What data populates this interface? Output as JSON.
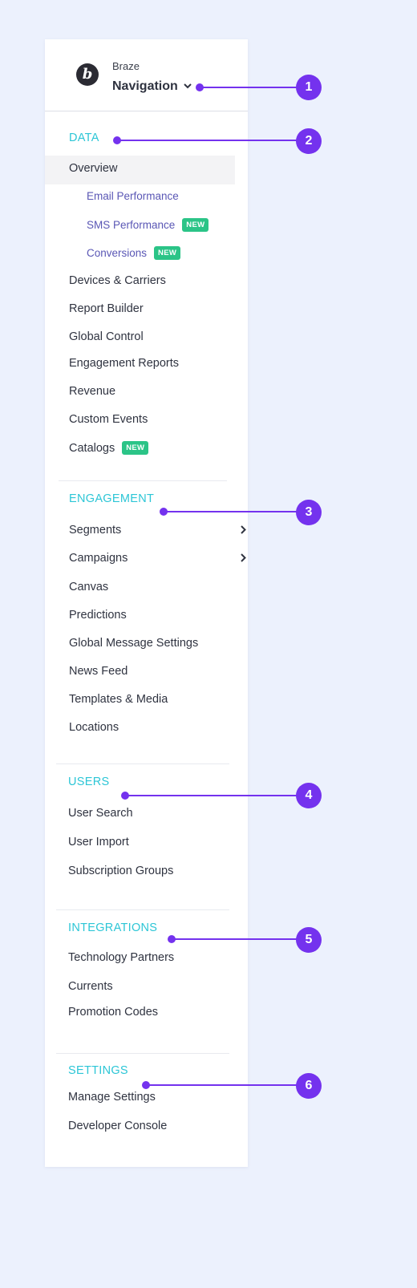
{
  "header": {
    "brand": "Braze",
    "title": "Navigation"
  },
  "data_section": {
    "heading": "DATA",
    "overview": "Overview",
    "sub_items": [
      {
        "label": "Email Performance"
      },
      {
        "label": "SMS Performance",
        "badge": "NEW"
      },
      {
        "label": "Conversions",
        "badge": "NEW"
      }
    ],
    "items": [
      {
        "label": "Devices & Carriers"
      },
      {
        "label": "Report Builder"
      },
      {
        "label": "Global Control"
      },
      {
        "label": "Engagement Reports"
      },
      {
        "label": "Revenue"
      },
      {
        "label": "Custom Events"
      },
      {
        "label": "Catalogs",
        "badge": "NEW"
      }
    ]
  },
  "engagement_section": {
    "heading": "ENGAGEMENT",
    "items": [
      {
        "label": "Segments"
      },
      {
        "label": "Campaigns"
      },
      {
        "label": "Canvas"
      },
      {
        "label": "Predictions"
      },
      {
        "label": "Global Message Settings"
      },
      {
        "label": "News Feed"
      },
      {
        "label": "Templates & Media"
      },
      {
        "label": "Locations"
      }
    ]
  },
  "users_section": {
    "heading": "USERS",
    "items": [
      {
        "label": "User Search"
      },
      {
        "label": "User Import"
      },
      {
        "label": "Subscription Groups"
      }
    ]
  },
  "integrations_section": {
    "heading": "INTEGRATIONS",
    "items": [
      {
        "label": "Technology Partners"
      },
      {
        "label": "Currents"
      },
      {
        "label": "Promotion Codes"
      }
    ]
  },
  "settings_section": {
    "heading": "SETTINGS",
    "items": [
      {
        "label": "Manage Settings"
      },
      {
        "label": "Developer Console"
      }
    ]
  },
  "callouts": [
    "1",
    "2",
    "3",
    "4",
    "5",
    "6"
  ],
  "colors": {
    "accent": "#7432ee",
    "section_heading": "#2cc6d6",
    "badge": "#2bc487",
    "background": "#ecf1fd"
  }
}
